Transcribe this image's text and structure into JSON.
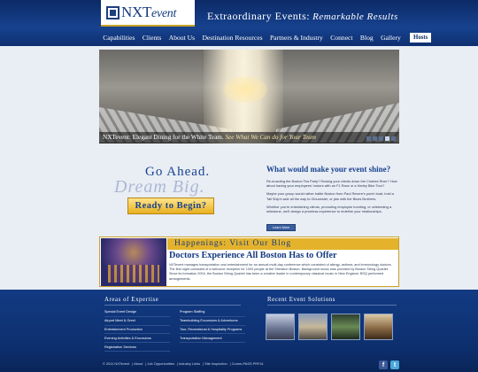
{
  "header": {
    "logo_main": "NXT",
    "logo_suffix": "event",
    "tagline_caps": "Extraordinary Events:",
    "tagline_script": "Remarkable Results"
  },
  "nav": {
    "items": [
      "Capabilities",
      "Clients",
      "About Us",
      "Destination Resources",
      "Partners & Industry",
      "Connect",
      "Blog",
      "Gallery"
    ],
    "hosts": "Hosts"
  },
  "hero": {
    "caption_lead": "NXTevent: Elegant Dining for the White Team.",
    "caption_link": "See What We Can do for Your Team",
    "slide_count": 5,
    "active_slide": 4
  },
  "cta": {
    "title": "Go Ahead.",
    "script": "Dream Big.",
    "button": "Ready to Begin?"
  },
  "shine": {
    "title": "What would make your event shine?",
    "paragraphs": [
      "Re-enacting the Boston Tea Party? Rowing your clients down the Charles River? How about having your employees' motors with an F1 Race or a Harley Bike Tour?",
      "Maybe your group would rather battle Boston from Paul Revere's porch boat, hold a Tall Ship's sale all the way to Gloucester, or jam with the Blues Brothers.",
      "Whether you're entertaining clients, promoting employee bonding, or celebrating a milestone, we'll design a priceless experience to redefine your relationships."
    ],
    "button": "Learn More"
  },
  "blog": {
    "bar_title": "Happenings: Visit Our Blog",
    "headline": "Doctors Experience All Boston Has to Offer",
    "text": "NXTevent manages transportation and entertainment for an annual multi-day conference which consisted of allergy, asthma, and immunology doctors. The first night consisted of a welcome reception for 1000 people at the Sheraton Boston. Background music was provided by Boston String Quartet. Since its formation 2004, the Boston String Quartet has been a creative leader in contemporary classical music in New England. BSQ performed arrangements."
  },
  "footer": {
    "expertise_title": "Areas of Expertise",
    "expertise_col1": [
      "Special Event Design",
      "Airport Meet & Greet",
      "Entertainment Production",
      "Evening Activities & Excursions",
      "Registration Services"
    ],
    "expertise_col2": [
      "Program Staffing",
      "Teambuilding Excursions & Adventures",
      "Tour, Recreational & Hospitality Programs",
      "Transportation Management"
    ],
    "recent_title": "Recent Event Solutions",
    "copyright": "© 2011 NXTevent",
    "links": [
      "About",
      "Job Opportunities",
      "Industry Links",
      "Site Inspection",
      "Comm-PASS PRF41"
    ],
    "social": [
      "f",
      "t"
    ]
  },
  "colors": {
    "navy": "#17428f",
    "gold": "#e4b32b",
    "facebook": "#3b5998",
    "twitter": "#4ca8d8"
  }
}
